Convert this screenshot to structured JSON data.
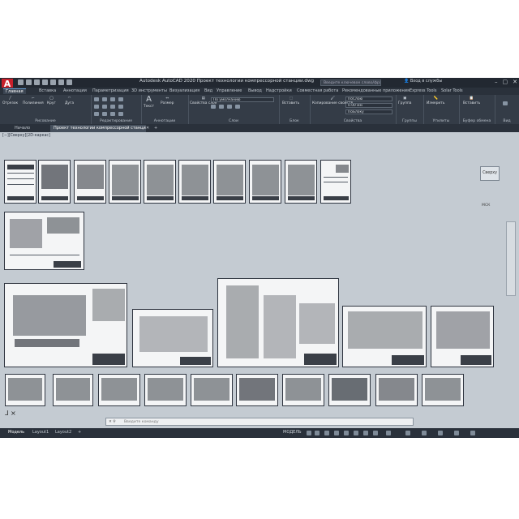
{
  "app": {
    "logo": "A",
    "title": "Autodesk AutoCAD 2020   Проект технологии компрессорной станции.dwg",
    "search_placeholder": "Введите ключевое слово/фразу",
    "signin": "Вход в службы"
  },
  "ribbon_tabs": [
    "Главная",
    "Вставка",
    "Аннотации",
    "Параметризация",
    "3D инструменты",
    "Визуализация",
    "Вид",
    "Управление",
    "Вывод",
    "Надстройки",
    "Совместная работа",
    "Рекомендованные приложения",
    "Express Tools",
    "Solar Tools"
  ],
  "ribbon": {
    "draw": {
      "label": "Рисование",
      "tools": [
        "Отрезок",
        "Полилиния",
        "Круг",
        "Дуга"
      ]
    },
    "modify": {
      "label": "Редактирование"
    },
    "annot": {
      "label": "Аннотации",
      "tools": [
        "Текст",
        "Размер"
      ]
    },
    "block": {
      "label": "Слои",
      "tools": [
        "Свойства слоя"
      ],
      "layer_value": "По умолчанию"
    },
    "insert": {
      "label": "Блок",
      "tools": [
        "Вставить"
      ]
    },
    "props": {
      "label": "Свойства",
      "tools": [
        "Копирование свойств"
      ],
      "color": "ПоСлою",
      "lineweight": "0.00 мм",
      "linetype": "ПоБлоку"
    },
    "groups": {
      "label": "Группы",
      "tools": [
        "Группа"
      ]
    },
    "utils": {
      "label": "Утилиты",
      "tools": [
        "Измерить"
      ]
    },
    "clip": {
      "label": "Буфер обмена",
      "tools": [
        "Вставить"
      ]
    },
    "view": {
      "label": "Вид"
    }
  },
  "doc_tabs": [
    "Начало",
    "Проект технологии компрессорной станции"
  ],
  "view_label": "[−][Сверху][2D-каркас]",
  "viewcube": {
    "face": "Сверху",
    "wcs": "МСК"
  },
  "command": {
    "placeholder": "Введите команду"
  },
  "layout_tabs": [
    "Модель",
    "Layout1",
    "Layout2"
  ],
  "status": {
    "mode": "МОДЕЛЬ"
  }
}
